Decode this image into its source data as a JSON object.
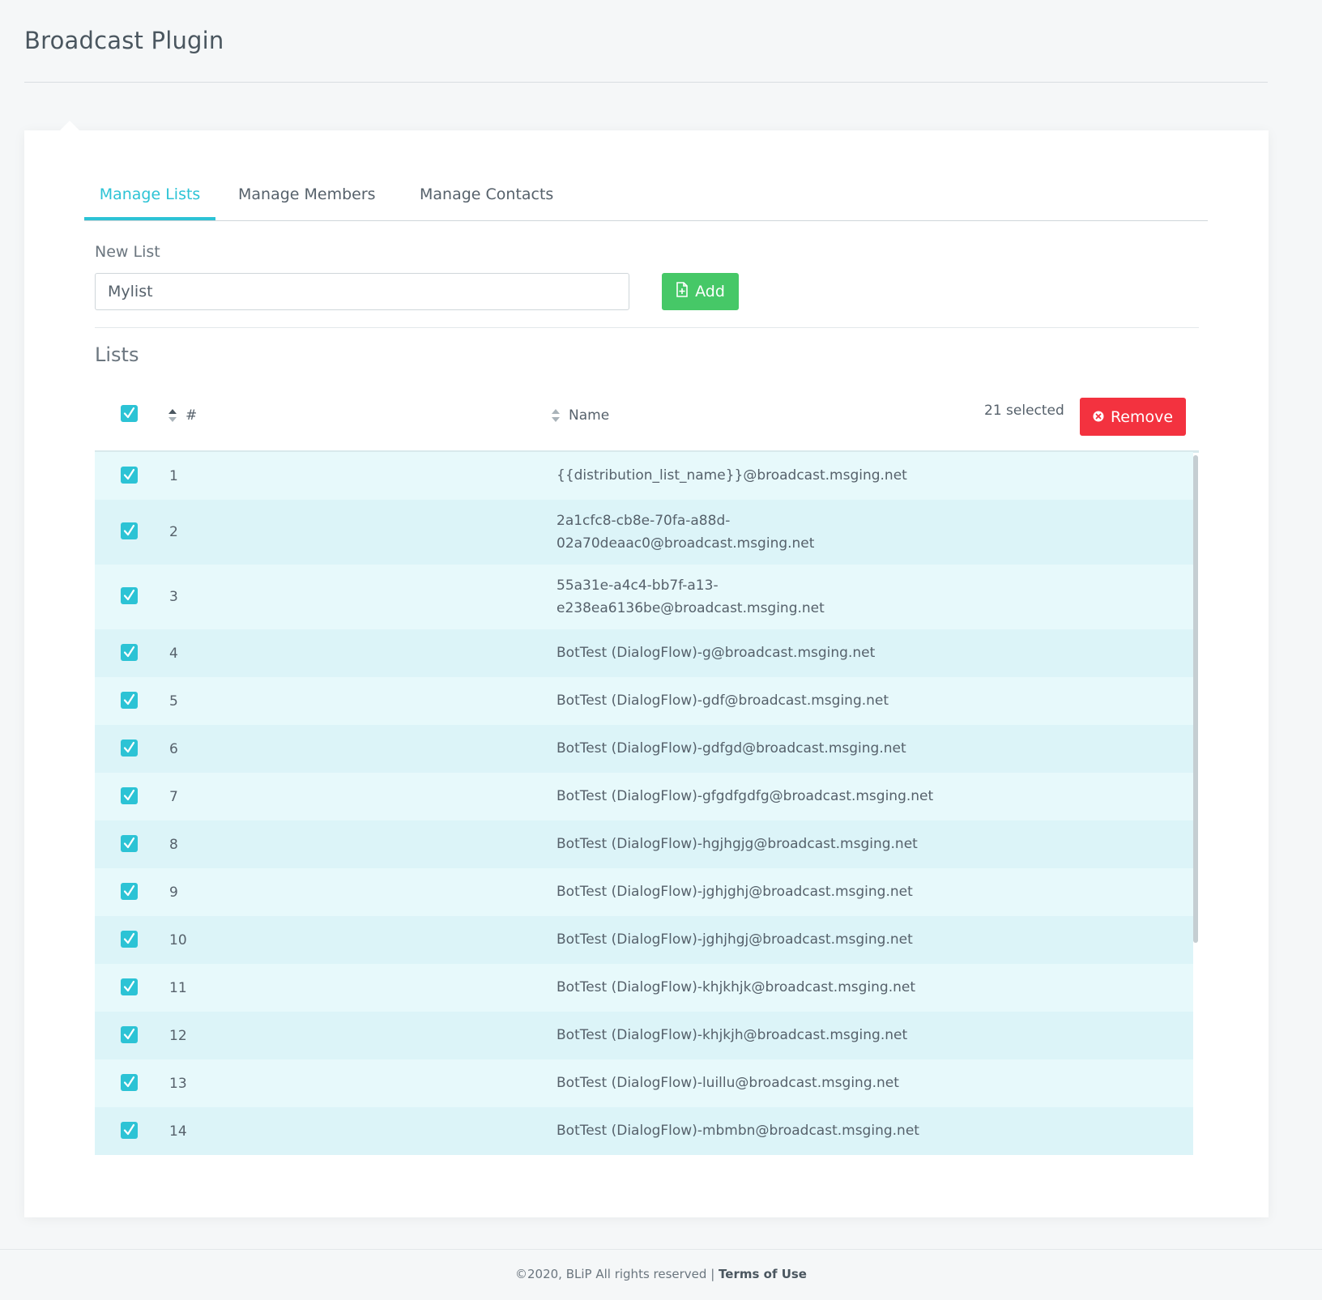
{
  "page": {
    "title": "Broadcast Plugin"
  },
  "tabs": [
    {
      "label": "Manage Lists",
      "active": true
    },
    {
      "label": "Manage Members",
      "active": false
    },
    {
      "label": "Manage Contacts",
      "active": false
    }
  ],
  "new_list": {
    "label": "New List",
    "value": "Mylist",
    "add_label": "Add",
    "add_icon": "file-plus-icon"
  },
  "lists": {
    "heading": "Lists",
    "columns": {
      "number": "#",
      "name": "Name"
    },
    "selected_text": "21 selected",
    "remove_label": "Remove",
    "remove_icon": "close-circle-icon",
    "rows": [
      {
        "num": "1",
        "name": "{{distribution_list_name}}@broadcast.msging.net",
        "checked": true
      },
      {
        "num": "2",
        "name": "2a1cfc8-cb8e-70fa-a88d-\n02a70deaac0@broadcast.msging.net",
        "checked": true
      },
      {
        "num": "3",
        "name": "55a31e-a4c4-bb7f-a13-\ne238ea6136be@broadcast.msging.net",
        "checked": true
      },
      {
        "num": "4",
        "name": "BotTest (DialogFlow)-g@broadcast.msging.net",
        "checked": true
      },
      {
        "num": "5",
        "name": "BotTest (DialogFlow)-gdf@broadcast.msging.net",
        "checked": true
      },
      {
        "num": "6",
        "name": "BotTest (DialogFlow)-gdfgd@broadcast.msging.net",
        "checked": true
      },
      {
        "num": "7",
        "name": "BotTest (DialogFlow)-gfgdfgdfg@broadcast.msging.net",
        "checked": true
      },
      {
        "num": "8",
        "name": "BotTest (DialogFlow)-hgjhgjg@broadcast.msging.net",
        "checked": true
      },
      {
        "num": "9",
        "name": "BotTest (DialogFlow)-jghjghj@broadcast.msging.net",
        "checked": true
      },
      {
        "num": "10",
        "name": "BotTest (DialogFlow)-jghjhgj@broadcast.msging.net",
        "checked": true
      },
      {
        "num": "11",
        "name": "BotTest (DialogFlow)-khjkhjk@broadcast.msging.net",
        "checked": true
      },
      {
        "num": "12",
        "name": "BotTest (DialogFlow)-khjkjh@broadcast.msging.net",
        "checked": true
      },
      {
        "num": "13",
        "name": "BotTest (DialogFlow)-luillu@broadcast.msging.net",
        "checked": true
      },
      {
        "num": "14",
        "name": "BotTest (DialogFlow)-mbmbn@broadcast.msging.net",
        "checked": true
      }
    ]
  },
  "footer": {
    "copyright": "©2020, BLiP All rights reserved |",
    "terms_label": "Terms of Use"
  },
  "colors": {
    "accent": "#2cc3d5",
    "add_button": "#46c867",
    "remove_button": "#f3323f"
  }
}
